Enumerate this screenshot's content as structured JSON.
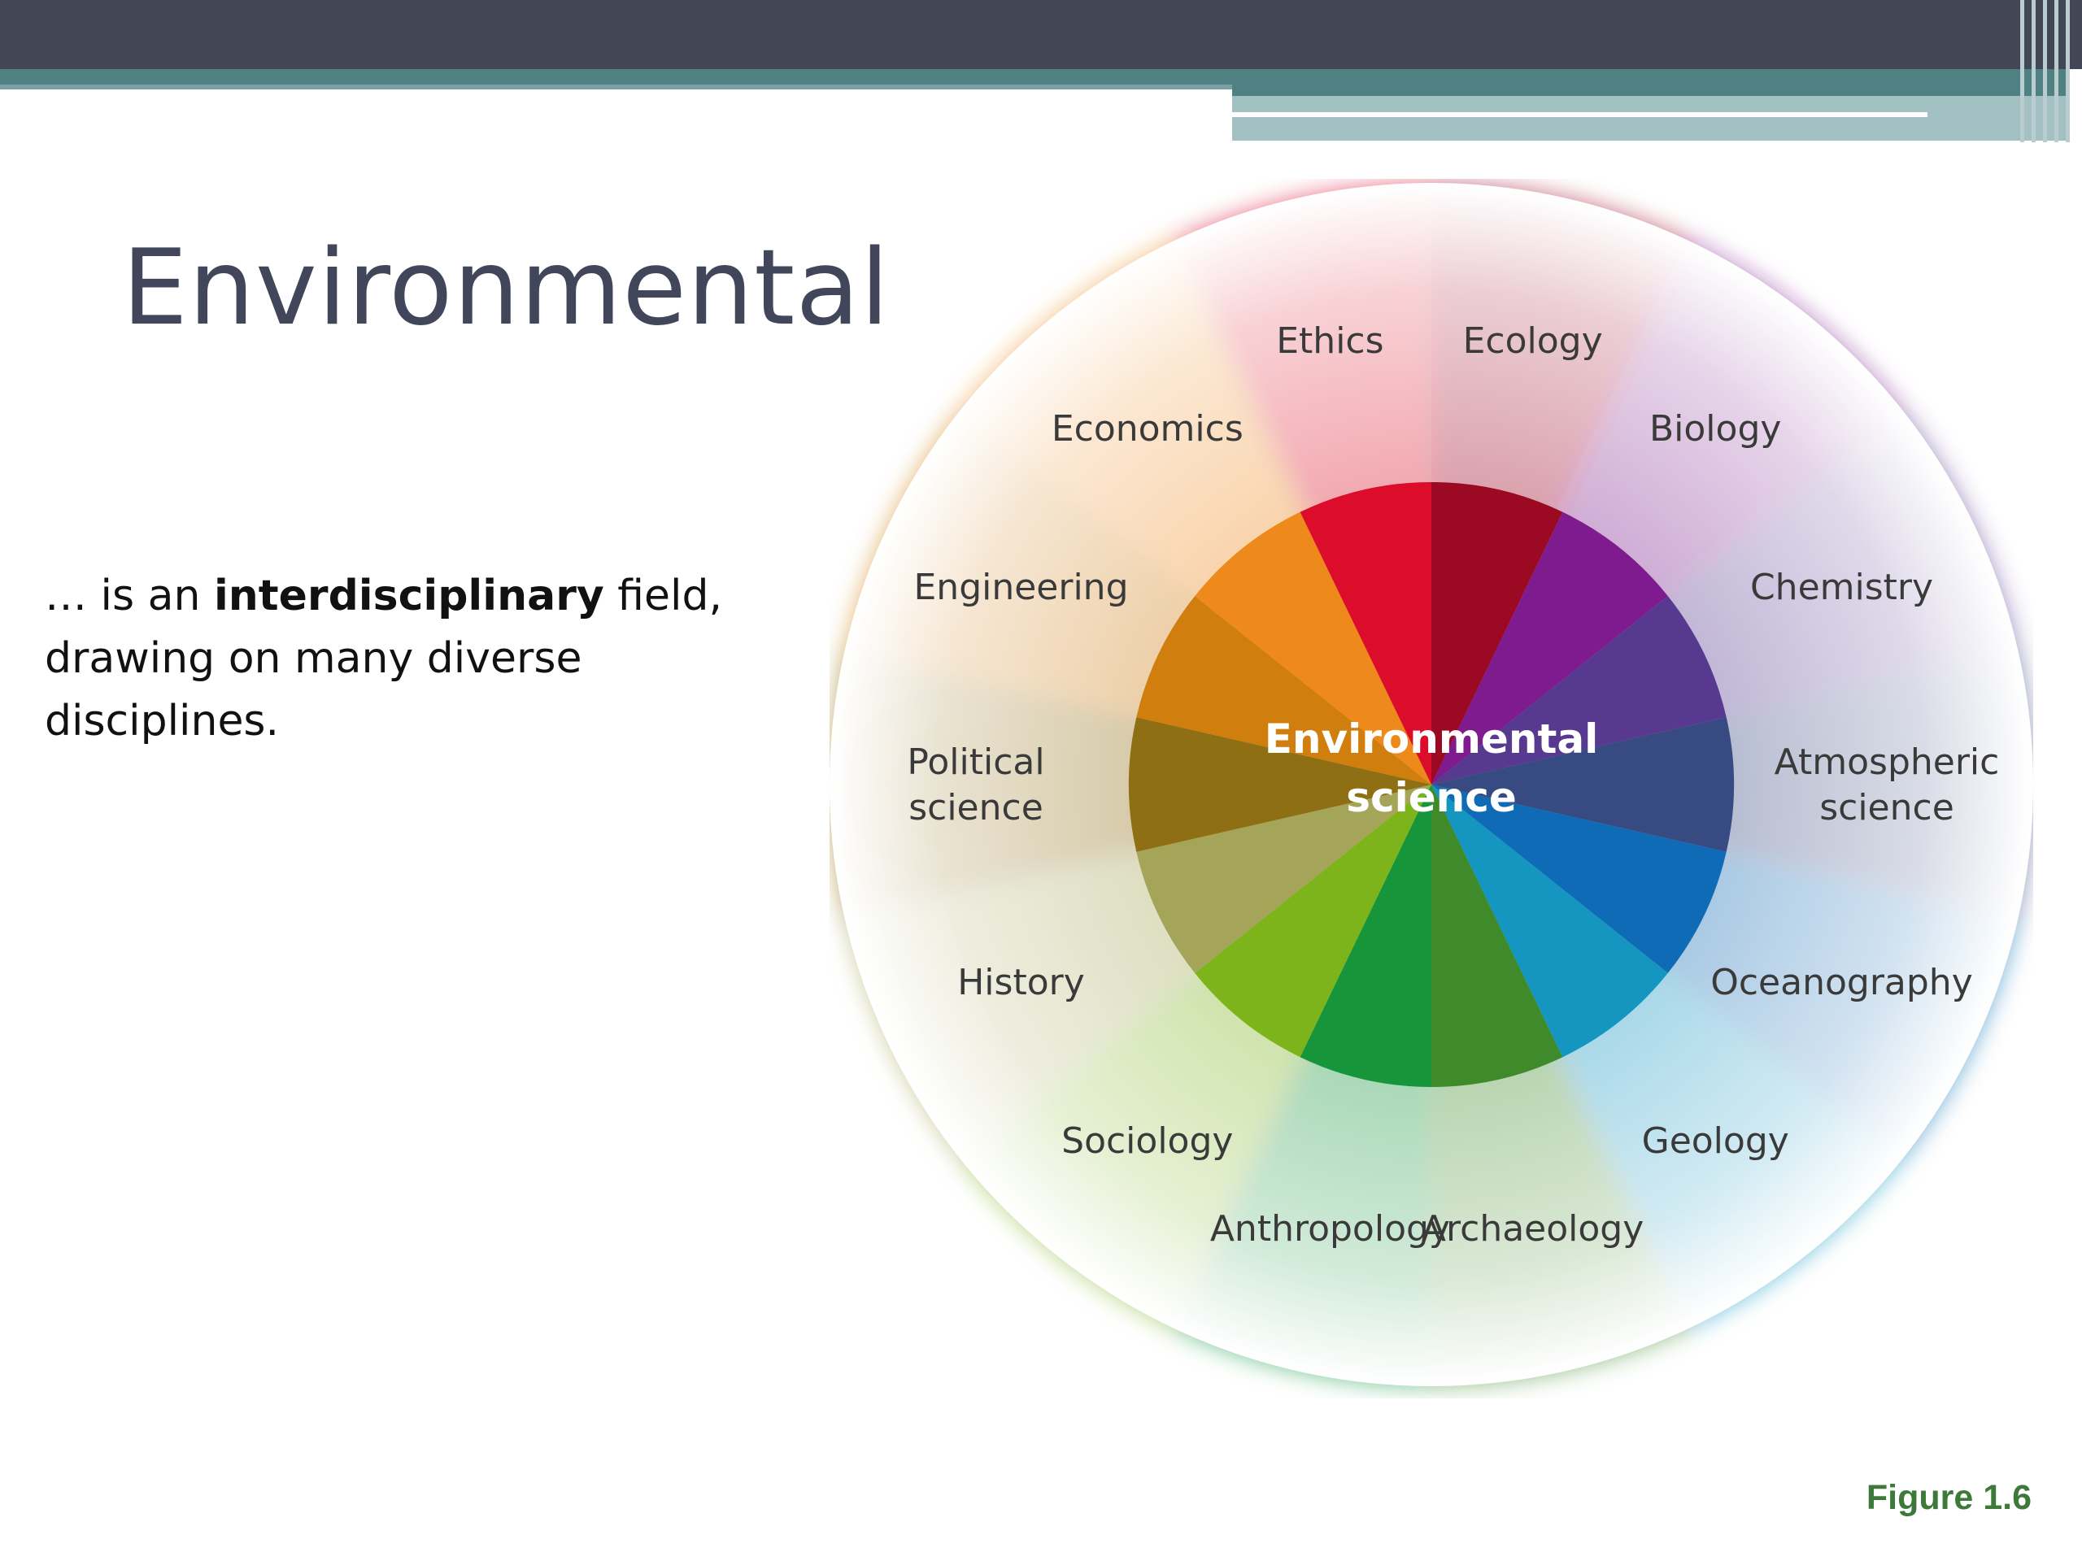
{
  "slide": {
    "title": "Environmental",
    "body_parts": [
      "… is an ",
      "interdisciplinary",
      " field,",
      "drawing on many diverse",
      "disciplines."
    ],
    "figure_caption": "Figure 1.6"
  },
  "diagram": {
    "center_label": [
      "Environmental",
      "science"
    ],
    "center_color": "#ffffff",
    "segments": [
      {
        "label": [
          "Ecology"
        ],
        "color": "#9b0a22"
      },
      {
        "label": [
          "Biology"
        ],
        "color": "#7e1b8e"
      },
      {
        "label": [
          "Chemistry"
        ],
        "color": "#573a8f"
      },
      {
        "label": [
          "Atmospheric",
          "science"
        ],
        "color": "#384a82"
      },
      {
        "label": [
          "Oceanography"
        ],
        "color": "#0f6bb5"
      },
      {
        "label": [
          "Geology"
        ],
        "color": "#1596c1"
      },
      {
        "label": [
          "Archaeology"
        ],
        "color": "#3f8a2a"
      },
      {
        "label": [
          "Anthropology"
        ],
        "color": "#17953b"
      },
      {
        "label": [
          "Sociology"
        ],
        "color": "#7db41b"
      },
      {
        "label": [
          "History"
        ],
        "color": "#a5a55a"
      },
      {
        "label": [
          "Political",
          "science"
        ],
        "color": "#8f6f13"
      },
      {
        "label": [
          "Engineering"
        ],
        "color": "#d07e0e"
      },
      {
        "label": [
          "Economics"
        ],
        "color": "#ee8a1b"
      },
      {
        "label": [
          "Ethics"
        ],
        "color": "#dc0d2a"
      }
    ]
  }
}
